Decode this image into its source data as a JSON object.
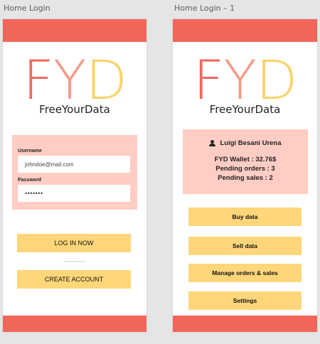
{
  "left_frame": {
    "title": "Home Login",
    "logo": {
      "f": "F",
      "y": "Y",
      "d": "D"
    },
    "brand": "FreeYourData",
    "form": {
      "username_label": "Username",
      "username_value": "johndoe@mail.com",
      "password_label": "Password",
      "password_value": "•••••••"
    },
    "login_button": "LOG IN NOW",
    "create_button": "CREATE ACCOUNT"
  },
  "right_frame": {
    "title": "Home Login – 1",
    "logo": {
      "f": "F",
      "y": "Y",
      "d": "D"
    },
    "brand": "FreeYourData",
    "user_name": "Luigi Besani Urena",
    "wallet": "FYD Wallet : 32.76$",
    "pending_orders": "Pending orders : 3",
    "pending_sales": "Pending sales : 2",
    "menu": [
      "Buy data",
      "Sell data",
      "Manage orders & sales",
      "Settings"
    ]
  },
  "colors": {
    "accent_red": "#f2665a",
    "pink_panel": "#ffcdc4",
    "button_yellow": "#ffd77a"
  },
  "icons": {
    "user": "user-icon"
  }
}
